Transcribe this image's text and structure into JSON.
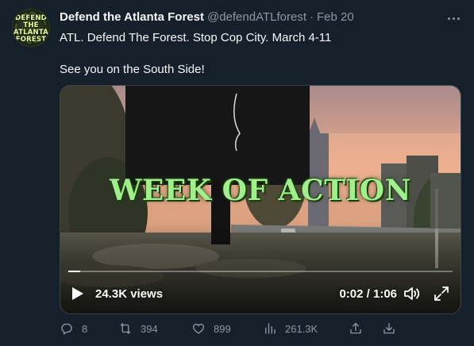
{
  "tweet": {
    "author_name": "Defend the Atlanta Forest",
    "handle": "@defendATLforest",
    "separator": "·",
    "date": "Feb 20",
    "text_line1": "ATL. Defend The Forest. Stop Cop City. March 4-11",
    "text_line2": "See you on the South Side!",
    "avatar_text": "DEFEND THE ATLANTA FOREST"
  },
  "video": {
    "overlay_title": "WEEK OF ACTION",
    "views_label": "24.3K views",
    "timecode": "0:02 / 1:06",
    "progress": 0.03
  },
  "actions": {
    "replies": "8",
    "retweets": "394",
    "likes": "899",
    "views": "261.3K"
  },
  "icons": {
    "more": "more-icon",
    "play": "play-icon",
    "volume": "volume-icon",
    "fullscreen": "fullscreen-icon",
    "reply": "reply-icon",
    "retweet": "retweet-icon",
    "like": "heart-icon",
    "analytics": "analytics-icon",
    "share": "share-icon",
    "download": "download-icon"
  },
  "colors": {
    "background": "#15202b",
    "secondary_text": "#8b98a5",
    "overlay_green": "#9ff08a"
  }
}
